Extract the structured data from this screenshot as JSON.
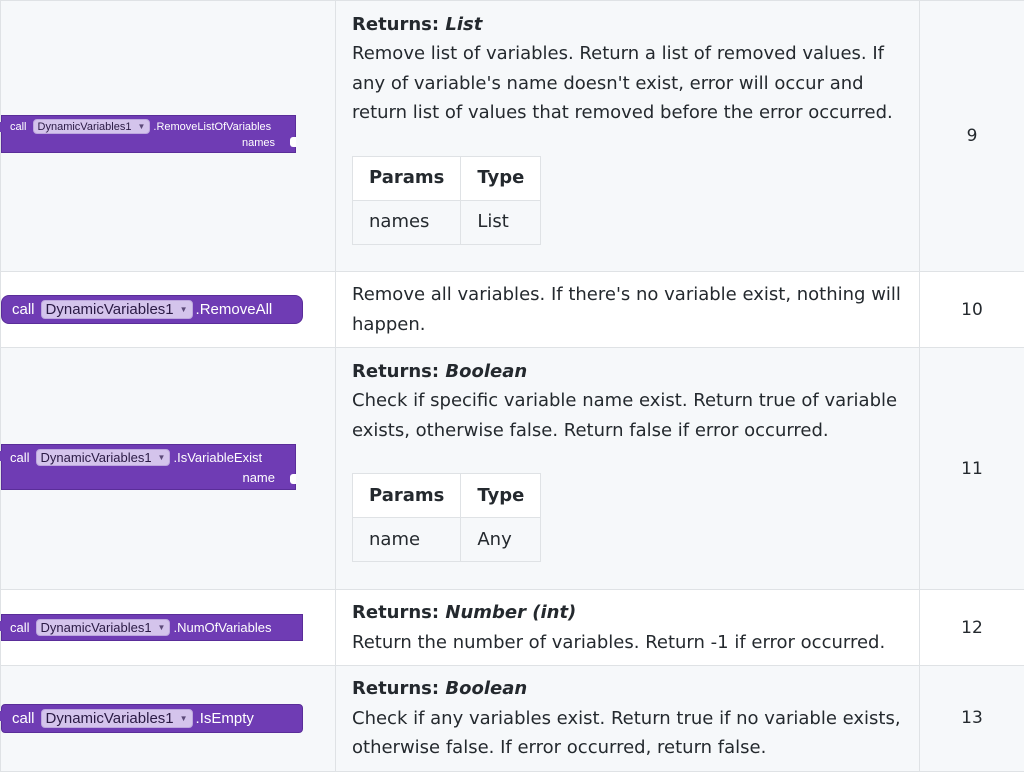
{
  "rows": [
    {
      "block": {
        "keyword": "call",
        "component": "DynamicVariables1",
        "method": ".RemoveListOfVariables",
        "param": "names"
      },
      "returns_label": "Returns:",
      "returns_type": "List",
      "description": "Remove list of variables. Return a list of removed values. If any of variable's name doesn't exist, error will occur and return list of values that removed before the error occurred.",
      "params_header": [
        "Params",
        "Type"
      ],
      "params": [
        [
          "names",
          "List"
        ]
      ],
      "number": "9"
    },
    {
      "block": {
        "keyword": "call",
        "component": "DynamicVariables1",
        "method": ".RemoveAll"
      },
      "description": "Remove all variables. If there's no variable exist, nothing will happen.",
      "number": "10"
    },
    {
      "block": {
        "keyword": "call",
        "component": "DynamicVariables1",
        "method": ".IsVariableExist",
        "param": "name"
      },
      "returns_label": "Returns:",
      "returns_type": "Boolean",
      "description": "Check if specific variable name exist. Return true of variable exists, otherwise false. Return false if error occurred.",
      "params_header": [
        "Params",
        "Type"
      ],
      "params": [
        [
          "name",
          "Any"
        ]
      ],
      "number": "11"
    },
    {
      "block": {
        "keyword": "call",
        "component": "DynamicVariables1",
        "method": ".NumOfVariables"
      },
      "returns_label": "Returns:",
      "returns_type": "Number (int)",
      "description": "Return the number of variables. Return -1 if error occurred.",
      "number": "12"
    },
    {
      "block": {
        "keyword": "call",
        "component": "DynamicVariables1",
        "method": ".IsEmpty"
      },
      "returns_label": "Returns:",
      "returns_type": "Boolean",
      "description": "Check if any variables exist. Return true if no variable exists, otherwise false. If error occurred, return false.",
      "number": "13"
    }
  ],
  "colors": {
    "block": "#6f3cb4",
    "component_chip": "#d4c4ec",
    "row_alt": "#f6f8fa",
    "border": "#dfe2e5"
  }
}
